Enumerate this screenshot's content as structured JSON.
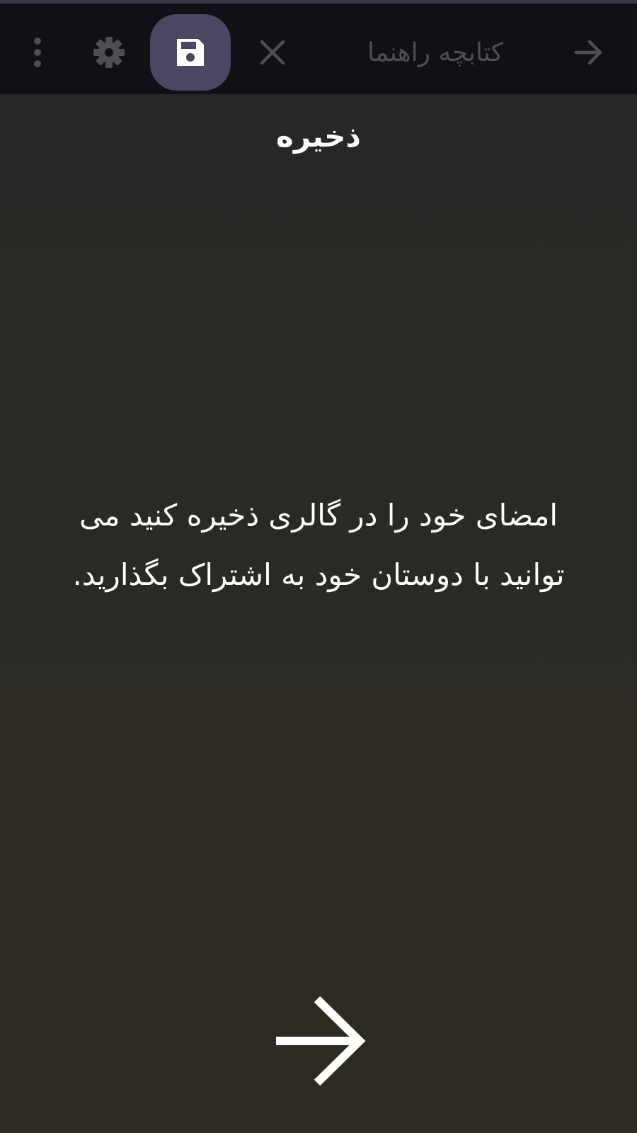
{
  "app_bar": {
    "title": "کتابچه راهنما",
    "back_icon": "arrow-right-icon",
    "close_icon": "close-icon",
    "save_icon": "floppy-disk-save-icon",
    "settings_icon": "gear-icon",
    "overflow_icon": "vertical-ellipsis-icon",
    "colors": {
      "bar_background": "#101016",
      "active_button_background": "#4a4763",
      "inactive_icon": "#4d4d52"
    }
  },
  "page": {
    "section_title": "ذخیره",
    "description": "امضای خود را در گالری ذخیره کنید می توانید با دوستان خود به اشتراک بگذارید.",
    "next_icon": "arrow-right-icon"
  }
}
